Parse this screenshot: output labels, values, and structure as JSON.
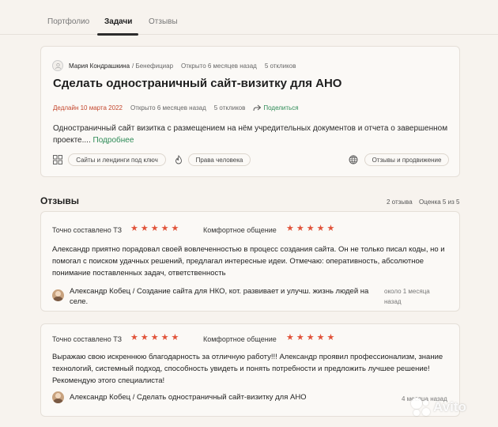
{
  "tabs": [
    {
      "label": "Портфолио"
    },
    {
      "label": "Задачи"
    },
    {
      "label": "Отзывы"
    }
  ],
  "task": {
    "author_name": "Мария Кондрашкина",
    "author_role": "/ Бенефициар",
    "opened": "Открыто 6 месяцев назад",
    "responses": "5 откликов",
    "title": "Сделать одностраничный сайт-визитку для АНО",
    "deadline": "Дедлайн 10 марта 2022",
    "share_label": "Поделиться",
    "description": "Одностраничный сайт визитка с размещением на нём учредительных документов и отчета о завершенном проекте....",
    "more_label": "Подробнее",
    "categories": [
      {
        "label": "Сайты и лендинги под ключ",
        "icon": "grid-icon"
      },
      {
        "label": "Права человека",
        "icon": "flame-icon"
      },
      {
        "label": "Отзывы и продвижение",
        "icon": "globe-icon"
      }
    ]
  },
  "reviews_section": {
    "title": "Отзывы",
    "count": "2 отзыва",
    "rating": "Оценка 5 из 5"
  },
  "reviews": [
    {
      "criteria": [
        {
          "label": "Точно составлено ТЗ",
          "stars": 5
        },
        {
          "label": "Комфортное общение",
          "stars": 5
        }
      ],
      "text": "Александр приятно порадовал своей вовлеченностью в процесс создания сайта. Он не только писал коды, но и помогал с поиском удачных решений, предлагал интересные идеи. Отмечаю: оперативность, абсолютное понимание поставленных задач, ответственность",
      "author": "Александр Кобец / Создание сайта для НКО, кот. развивает и улучш. жизнь людей на селе.",
      "time": "около 1 месяца назад"
    },
    {
      "criteria": [
        {
          "label": "Точно составлено ТЗ",
          "stars": 5
        },
        {
          "label": "Комфортное общение",
          "stars": 5
        }
      ],
      "text": "Выражаю свою искреннюю благодарность за отличную работу!!! Александр проявил профессионализм, знание технологий, системный подход, способность увидеть и понять потребности и предложить лучшее решение! Рекомендую этого специалиста!",
      "author": "Александр Кобец / Сделать одностраничный сайт-визитку для АНО",
      "time": "4 месяца назад"
    }
  ],
  "watermark": "Avito",
  "colors": {
    "accent_green": "#2e8b57",
    "deadline_red": "#c4472e",
    "star": "#e1533a",
    "background": "#f7f3ee"
  }
}
